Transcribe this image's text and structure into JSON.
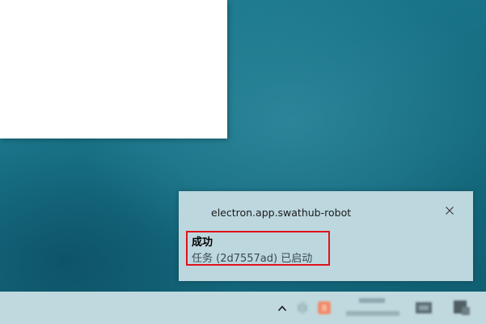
{
  "desktop": {
    "background_color": "#176f84"
  },
  "notification": {
    "app_name": "electron.app.swathub-robot",
    "title": "成功",
    "message": "任务 (2d7557ad) 已启动",
    "close_icon": "close-icon",
    "highlight_color": "#e0121a",
    "background_color": "#bdd7df"
  },
  "taskbar": {
    "background_color": "#bfd9df",
    "tray_icons": [
      "chevron-up-icon",
      "app-tray-icon",
      "app-tray-icon-orange",
      "network-icon",
      "action-center-icon"
    ]
  }
}
